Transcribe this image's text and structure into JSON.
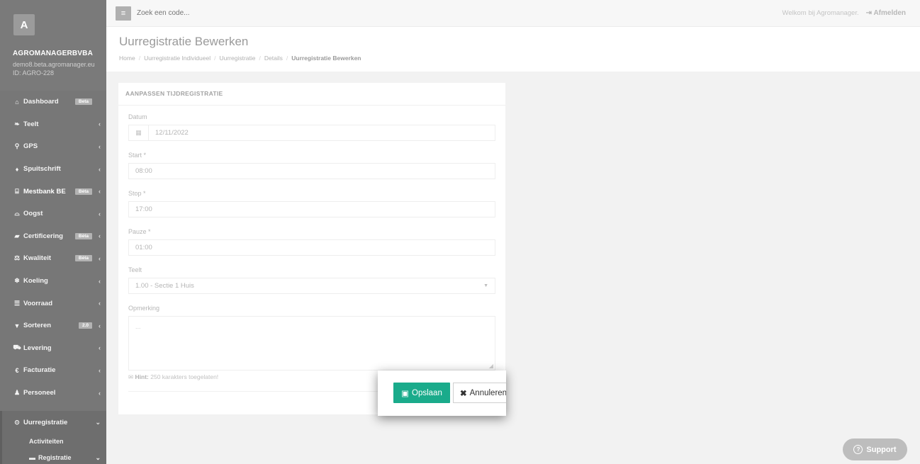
{
  "sidebar": {
    "avatar_letter": "A",
    "company": "AGROMANAGERBVBA",
    "domain": "demo8.beta.agromanager.eu",
    "id": "ID: AGRO-228",
    "items": [
      {
        "icon": "⌂",
        "label": "Dashboard",
        "badge": "Beta",
        "chev": ""
      },
      {
        "icon": "❧",
        "label": "Teelt",
        "badge": "",
        "chev": "‹"
      },
      {
        "icon": "⚲",
        "label": "GPS",
        "badge": "",
        "chev": "‹"
      },
      {
        "icon": "♦",
        "label": "Spuitschrift",
        "badge": "",
        "chev": "‹"
      },
      {
        "icon": "⌸",
        "label": "Mestbank BE",
        "badge": "Bèta",
        "chev": "‹"
      },
      {
        "icon": "⌓",
        "label": "Oogst",
        "badge": "",
        "chev": "‹"
      },
      {
        "icon": "▰",
        "label": "Certificering",
        "badge": "Bèta",
        "chev": "‹"
      },
      {
        "icon": "⚖",
        "label": "Kwaliteit",
        "badge": "Bèta",
        "chev": "‹"
      },
      {
        "icon": "❄",
        "label": "Koeling",
        "badge": "",
        "chev": "‹"
      },
      {
        "icon": "☰",
        "label": "Voorraad",
        "badge": "",
        "chev": "‹"
      },
      {
        "icon": "▼",
        "label": "Sorteren",
        "badge": "2.0",
        "chev": "‹"
      },
      {
        "icon": "⛟",
        "label": "Levering",
        "badge": "",
        "chev": "‹"
      },
      {
        "icon": "€",
        "label": "Facturatie",
        "badge": "",
        "chev": "‹"
      },
      {
        "icon": "♟",
        "label": "Personeel",
        "badge": "",
        "chev": "‹"
      },
      {
        "icon": "⊙",
        "label": "Uurregistratie",
        "badge": "",
        "chev": "⌄"
      }
    ],
    "sub_activiteiten": "Activiteiten",
    "sub_registratie": "Registratie",
    "sub_registratie_chev": "⌄"
  },
  "topbar": {
    "search_placeholder": "Zoek een code...",
    "welcome": "Welkom bij Agromanager.",
    "logout": "Afmelden"
  },
  "header": {
    "title": "Uurregistratie Bewerken",
    "breadcrumb": [
      "Home",
      "Uurregistratie Individueel",
      "Uurregistratie",
      "Details",
      "Uurregistratie Bewerken"
    ]
  },
  "form": {
    "card_title": "AANPASSEN TIJDREGISTRATIE",
    "datum_label": "Datum",
    "datum_value": "12/11/2022",
    "start_label": "Start *",
    "start_value": "08:00",
    "stop_label": "Stop *",
    "stop_value": "17:00",
    "pauze_label": "Pauze *",
    "pauze_value": "01:00",
    "teelt_label": "Teelt",
    "teelt_value": "1.00 - Sectie 1 Huis",
    "opmerking_label": "Opmerking",
    "opmerking_placeholder": "...",
    "hint_bold": "Hint:",
    "hint_text": "250 karakters toegelaten!"
  },
  "actions": {
    "save": "Opslaan",
    "cancel": "Annuleren"
  },
  "support": "Support"
}
